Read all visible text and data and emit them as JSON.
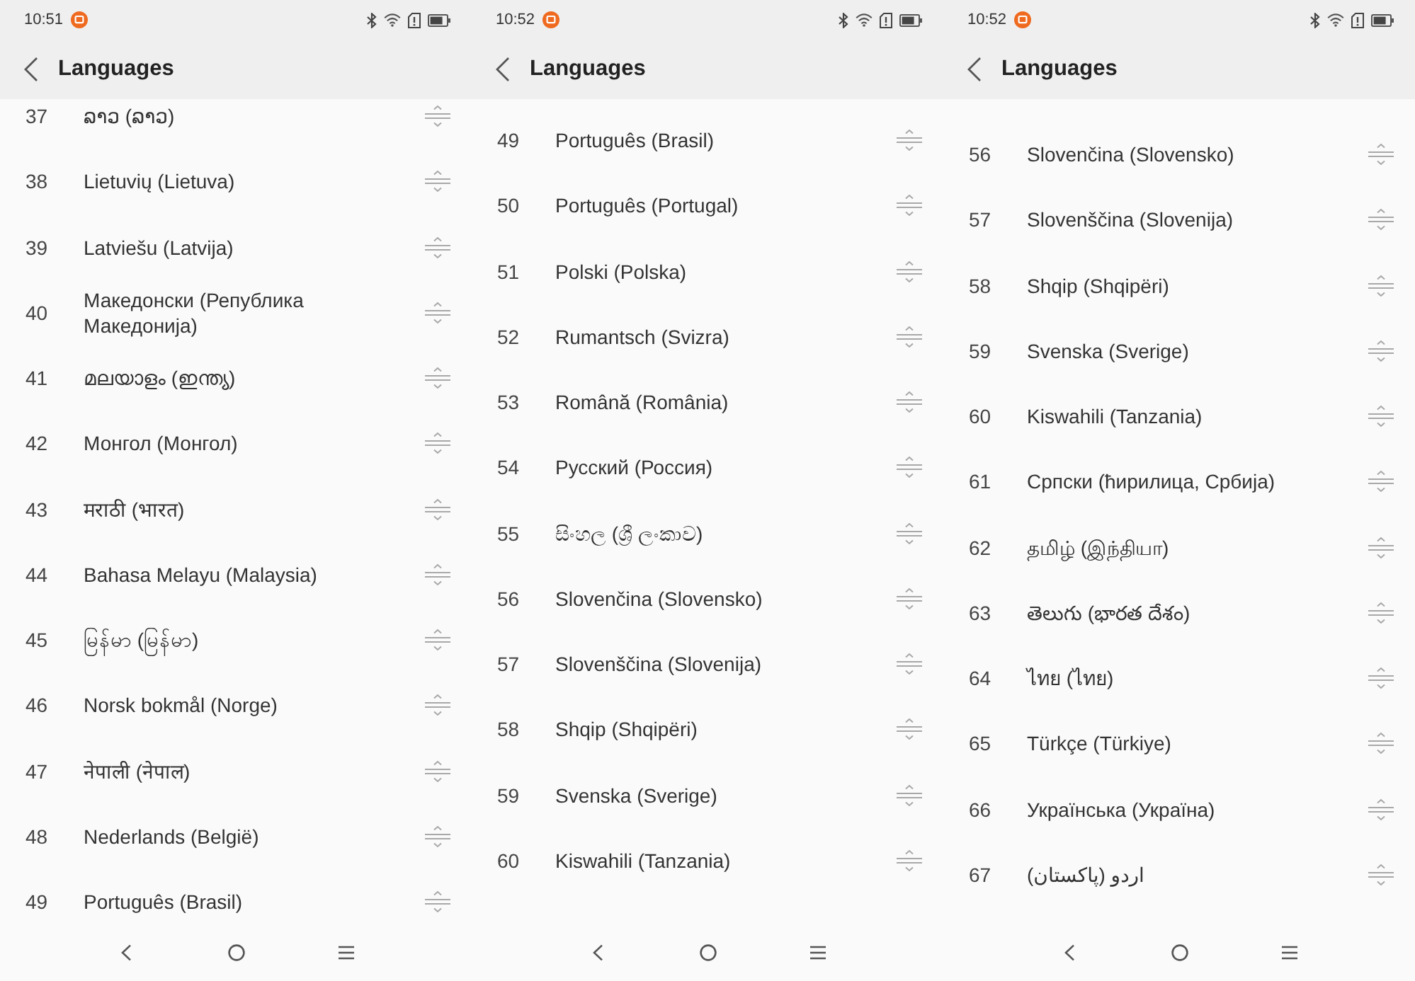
{
  "screens": [
    {
      "status_bar": {
        "time": "10:51"
      },
      "header": {
        "title": "Languages"
      },
      "languages": [
        {
          "number": "37",
          "name": "ລາວ (ລາວ)"
        },
        {
          "number": "38",
          "name": "Lietuvių (Lietuva)"
        },
        {
          "number": "39",
          "name": "Latviešu (Latvija)"
        },
        {
          "number": "40",
          "name": "Македонски (Република Македонија)"
        },
        {
          "number": "41",
          "name": "മലയാളം (ഇന്ത്യ)"
        },
        {
          "number": "42",
          "name": "Монгол (Монгол)"
        },
        {
          "number": "43",
          "name": "मराठी (भारत)"
        },
        {
          "number": "44",
          "name": "Bahasa Melayu (Malaysia)"
        },
        {
          "number": "45",
          "name": "မြန်မာ (မြန်မာ)"
        },
        {
          "number": "46",
          "name": "Norsk bokmål (Norge)"
        },
        {
          "number": "47",
          "name": "नेपाली (नेपाल)"
        },
        {
          "number": "48",
          "name": "Nederlands (België)"
        },
        {
          "number": "49",
          "name": "Português (Brasil)"
        }
      ]
    },
    {
      "status_bar": {
        "time": "10:52"
      },
      "header": {
        "title": "Languages"
      },
      "languages": [
        {
          "number": "49",
          "name": "Português (Brasil)"
        },
        {
          "number": "50",
          "name": "Português (Portugal)"
        },
        {
          "number": "51",
          "name": "Polski (Polska)"
        },
        {
          "number": "52",
          "name": "Rumantsch (Svizra)"
        },
        {
          "number": "53",
          "name": "Română (România)"
        },
        {
          "number": "54",
          "name": "Русский (Россия)"
        },
        {
          "number": "55",
          "name": "සිංහල (ශ්‍රී ලංකාව)"
        },
        {
          "number": "56",
          "name": "Slovenčina (Slovensko)"
        },
        {
          "number": "57",
          "name": "Slovenščina (Slovenija)"
        },
        {
          "number": "58",
          "name": "Shqip (Shqipëri)"
        },
        {
          "number": "59",
          "name": "Svenska (Sverige)"
        },
        {
          "number": "60",
          "name": "Kiswahili (Tanzania)"
        }
      ]
    },
    {
      "status_bar": {
        "time": "10:52"
      },
      "header": {
        "title": "Languages"
      },
      "languages": [
        {
          "number": "56",
          "name": "Slovenčina (Slovensko)"
        },
        {
          "number": "57",
          "name": "Slovenščina (Slovenija)"
        },
        {
          "number": "58",
          "name": "Shqip (Shqipëri)"
        },
        {
          "number": "59",
          "name": "Svenska (Sverige)"
        },
        {
          "number": "60",
          "name": "Kiswahili (Tanzania)"
        },
        {
          "number": "61",
          "name": "Српски (ћирилица, Србија)"
        },
        {
          "number": "62",
          "name": "தமிழ் (இந்தியா)"
        },
        {
          "number": "63",
          "name": "తెలుగు (భారత దేశం)"
        },
        {
          "number": "64",
          "name": "ไทย (ไทย)"
        },
        {
          "number": "65",
          "name": "Türkçe (Türkiye)"
        },
        {
          "number": "66",
          "name": "Українська (Україна)"
        },
        {
          "number": "67",
          "name": "اردو (پاکستان)"
        }
      ]
    }
  ]
}
